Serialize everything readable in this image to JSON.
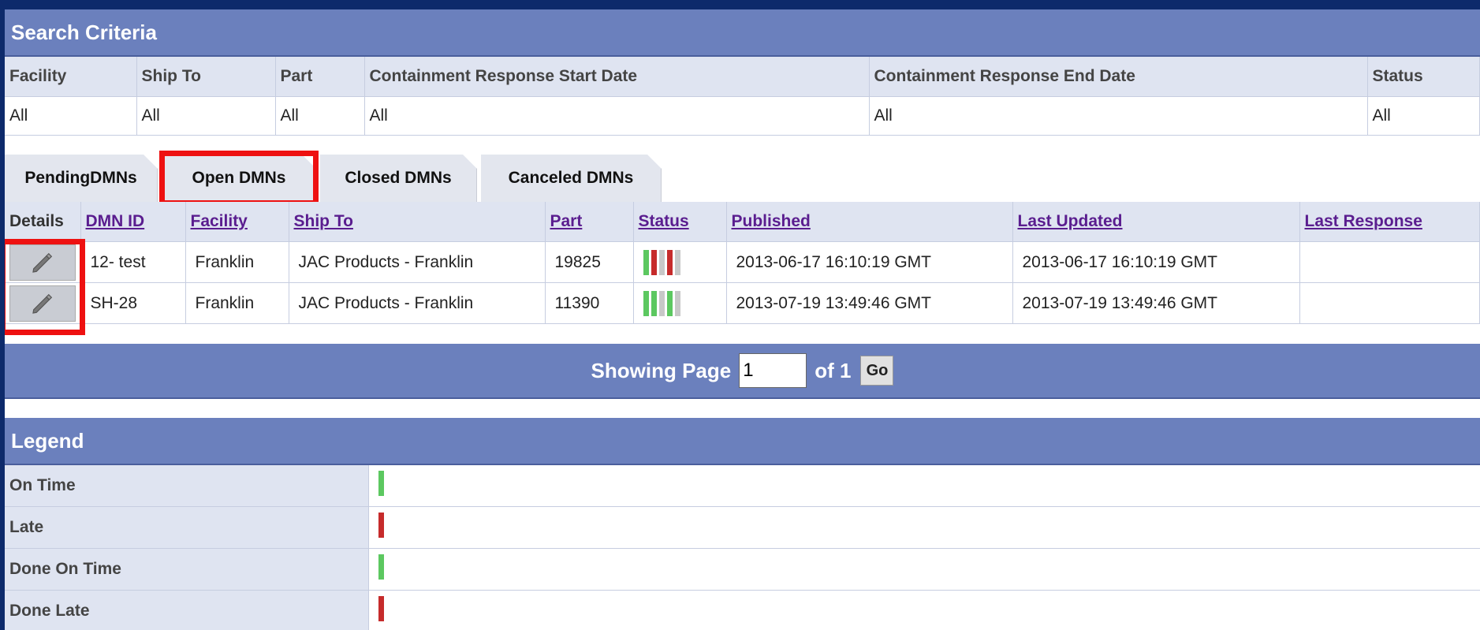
{
  "colors": {
    "header_bg": "#6b80bd",
    "on_time": "#5cc860",
    "late": "#c62b2b",
    "pending": "#c8c8c8",
    "highlight": "#ee1111"
  },
  "search": {
    "title": "Search Criteria",
    "columns": [
      "Facility",
      "Ship To",
      "Part",
      "Containment Response Start Date",
      "Containment Response End Date",
      "Status"
    ],
    "values": [
      "All",
      "All",
      "All",
      "All",
      "All",
      "All"
    ]
  },
  "tabs": [
    {
      "label": "PendingDMNs"
    },
    {
      "label": "Open DMNs"
    },
    {
      "label": "Closed DMNs"
    },
    {
      "label": "Canceled DMNs"
    }
  ],
  "results": {
    "columns": [
      "Details",
      "DMN ID",
      "Facility",
      "Ship To",
      "Part",
      "Status",
      "Published",
      "Last Updated",
      "Last Response"
    ],
    "rows": [
      {
        "dmn_id": "12- test",
        "facility": "Franklin",
        "ship_to": "JAC Products - Franklin",
        "part": "19825",
        "status": [
          "on_time",
          "late",
          "pending",
          "late",
          "pending"
        ],
        "published": "2013-06-17 16:10:19 GMT",
        "last_updated": "2013-06-17 16:10:19 GMT",
        "last_response": ""
      },
      {
        "dmn_id": "SH-28",
        "facility": "Franklin",
        "ship_to": "JAC Products - Franklin",
        "part": "11390",
        "status": [
          "on_time",
          "on_time",
          "pending",
          "on_time",
          "pending"
        ],
        "published": "2013-07-19 13:49:46 GMT",
        "last_updated": "2013-07-19 13:49:46 GMT",
        "last_response": ""
      }
    ]
  },
  "pager": {
    "label": "Showing Page",
    "current_page": "1",
    "of_label": "of 1",
    "go_label": "Go"
  },
  "legend": {
    "title": "Legend",
    "items": [
      {
        "label": "On Time",
        "color": "#5cc860"
      },
      {
        "label": "Late",
        "color": "#c62b2b"
      },
      {
        "label": "Done On Time",
        "color": "#5cc860"
      },
      {
        "label": "Done Late",
        "color": "#c62b2b"
      }
    ]
  }
}
